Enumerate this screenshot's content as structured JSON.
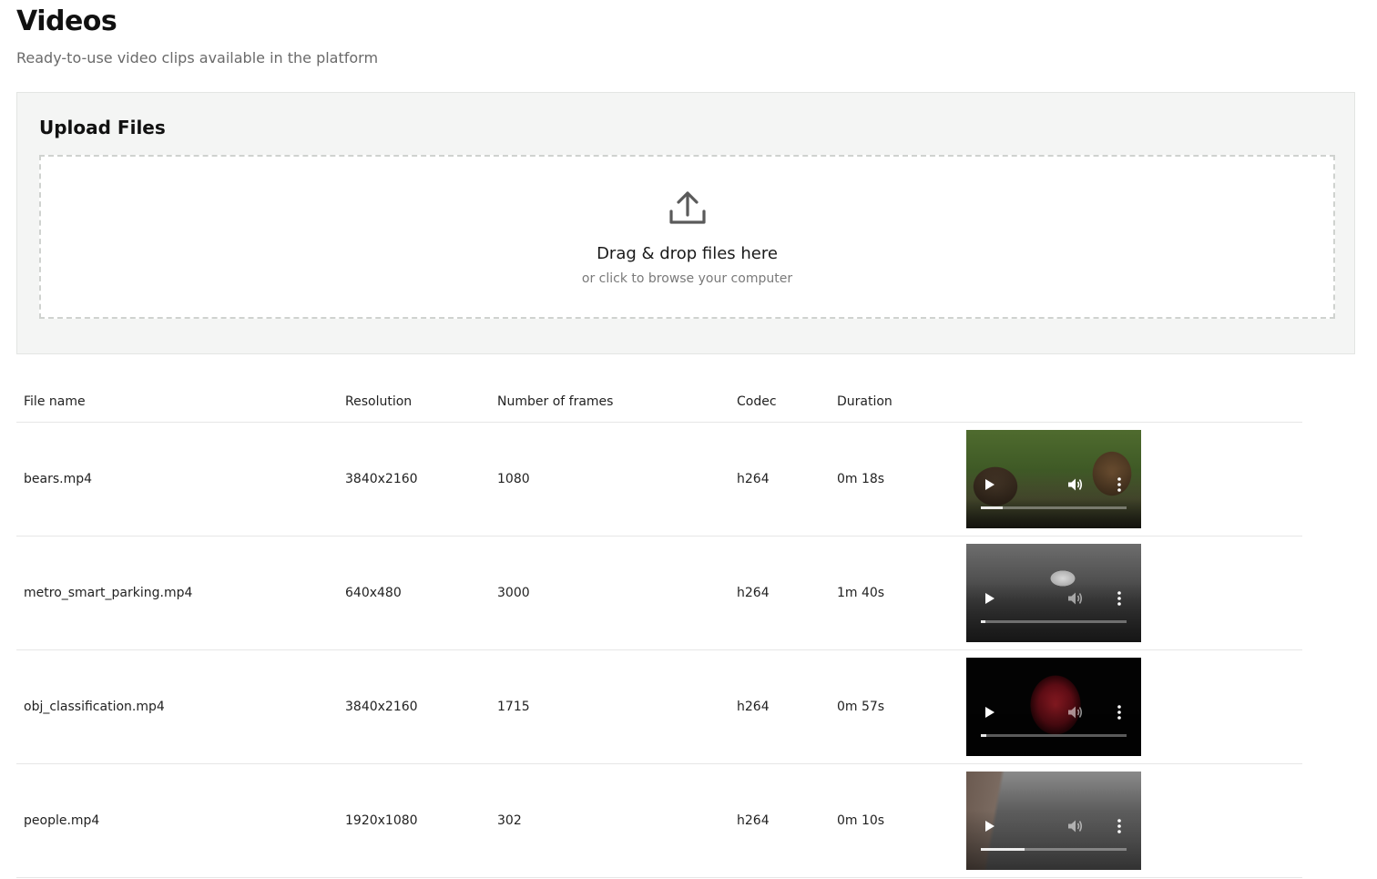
{
  "header": {
    "title": "Videos",
    "subtitle": "Ready-to-use video clips available in the platform"
  },
  "upload": {
    "title": "Upload Files",
    "drop_text": "Drag & drop files here",
    "browse_text": "or click to browse your computer",
    "icon": "upload-icon"
  },
  "table": {
    "columns": [
      "File name",
      "Resolution",
      "Number of frames",
      "Codec",
      "Duration"
    ],
    "rows": [
      {
        "file_name": "bears.mp4",
        "resolution": "3840x2160",
        "frames": "1080",
        "codec": "h264",
        "duration": "0m 18s",
        "progress": 0.15
      },
      {
        "file_name": "metro_smart_parking.mp4",
        "resolution": "640x480",
        "frames": "3000",
        "codec": "h264",
        "duration": "1m 40s",
        "progress": 0.03
      },
      {
        "file_name": "obj_classification.mp4",
        "resolution": "3840x2160",
        "frames": "1715",
        "codec": "h264",
        "duration": "0m 57s",
        "progress": 0.04
      },
      {
        "file_name": "people.mp4",
        "resolution": "1920x1080",
        "frames": "302",
        "codec": "h264",
        "duration": "0m 10s",
        "progress": 0.3
      }
    ]
  },
  "player_icons": [
    "play-icon",
    "volume-icon",
    "more-vertical-icon"
  ],
  "colors": {
    "panel_bg": "#f4f5f4",
    "dropzone_border": "#cfd2cf",
    "text_muted": "#6a6a6a"
  }
}
